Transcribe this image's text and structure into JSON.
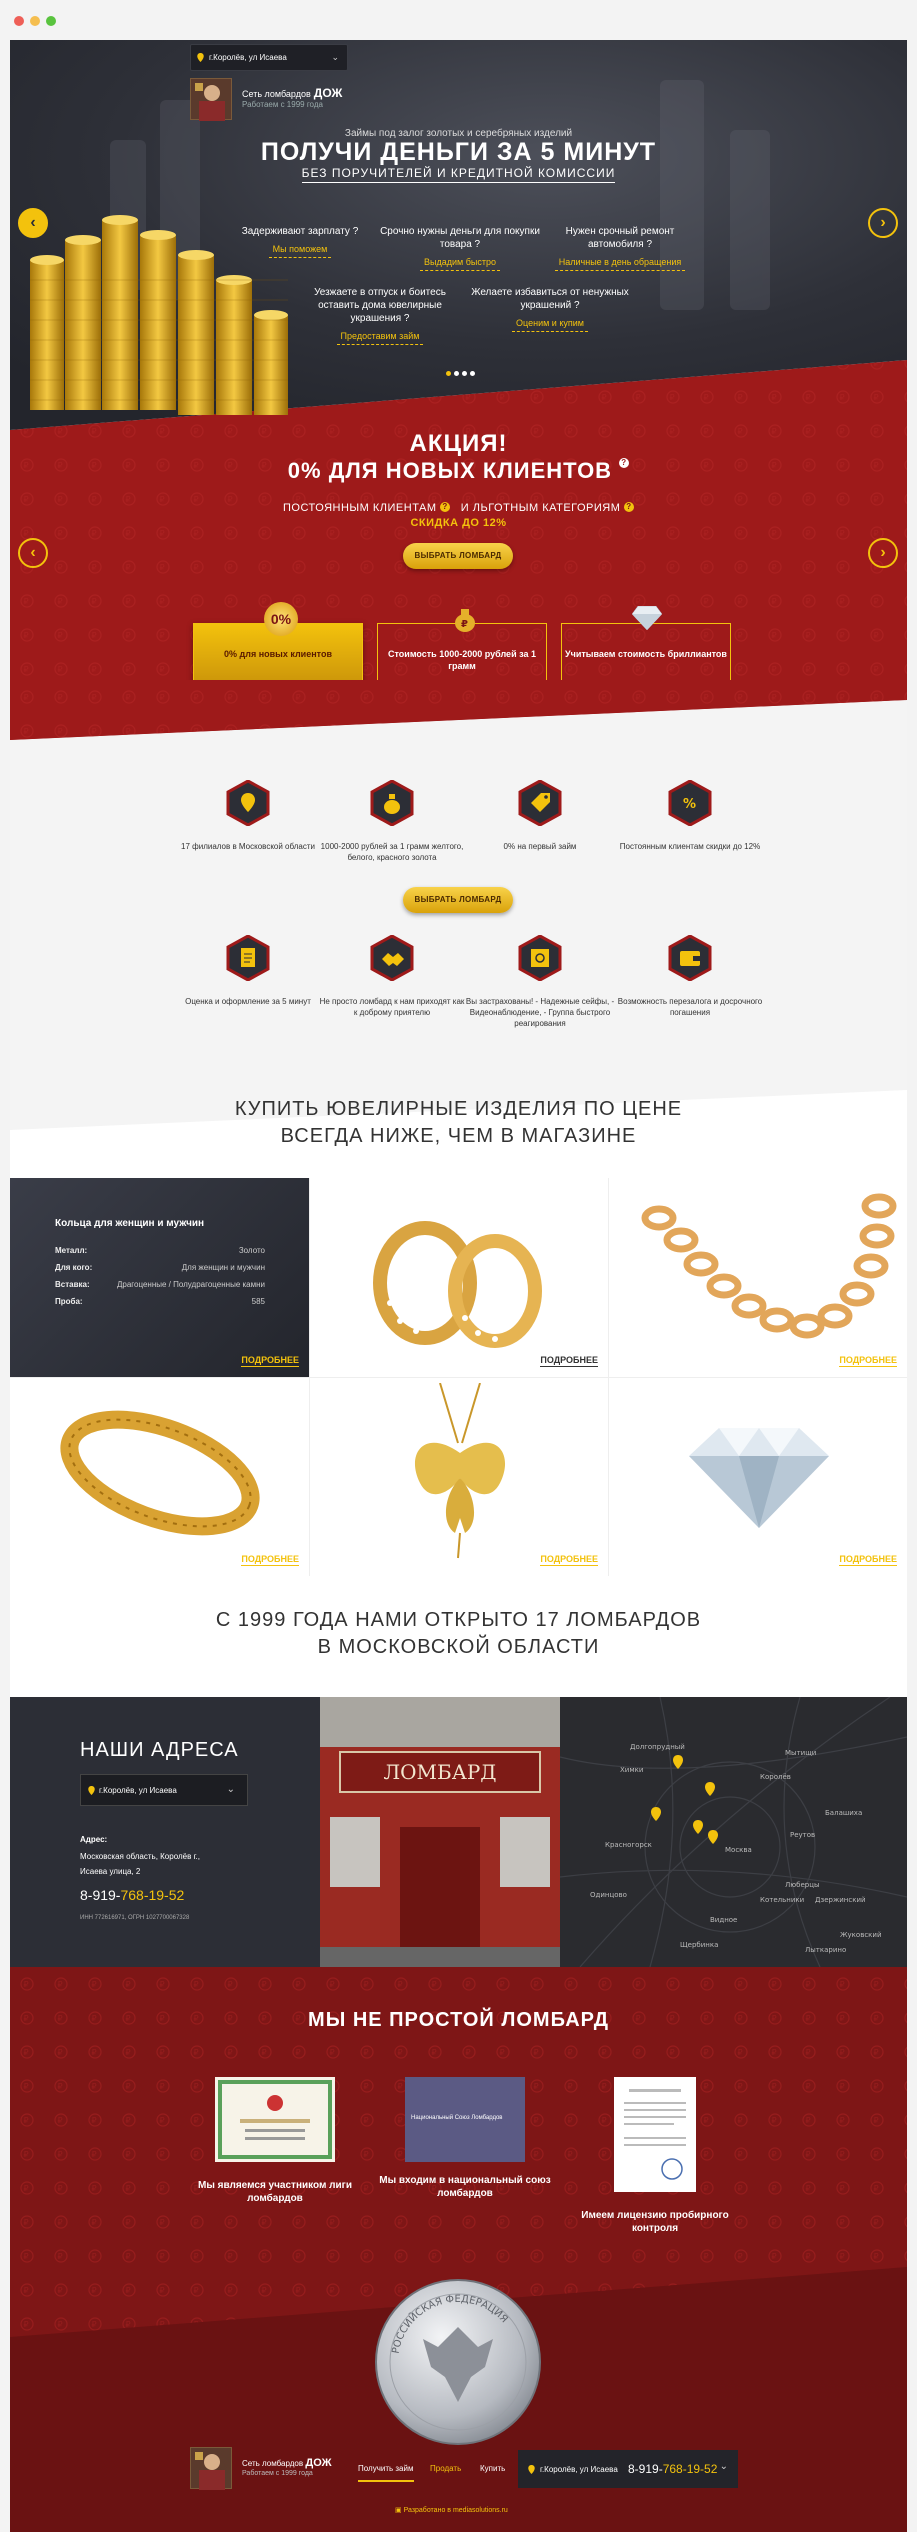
{
  "window": {
    "dots": [
      "#ee5f57",
      "#f5be4f",
      "#59c33e"
    ]
  },
  "hero": {
    "location": "г.Королёв, ул Исаева",
    "brand_prefix": "Сеть ломбардов",
    "brand_name": "ДОЖ",
    "since": "Работаем с 1999 года",
    "subtitle": "Займы под залог золотых и серебряных изделий",
    "title": "ПОЛУЧИ ДЕНЬГИ ЗА 5 МИНУТ",
    "subtitle2": "БЕЗ ПОРУЧИТЕЛЕЙ И КРЕДИТНОЙ КОМИССИИ",
    "features": [
      {
        "q": "Задерживают зарплату ?",
        "a": "Мы поможем"
      },
      {
        "q": "Срочно нужны деньги для покупки товара ?",
        "a": "Выдадим быстро"
      },
      {
        "q": "Нужен срочный ремонт автомобиля ?",
        "a": "Наличные в день обращения"
      },
      {
        "q": "Уезжаете в отпуск и боитесь оставить дома ювелирные украшения ?",
        "a": "Предоставим займ"
      },
      {
        "q": "Желаете избавиться от ненужных украшений ?",
        "a": "Оценим и купим"
      }
    ]
  },
  "promo": {
    "title": "АКЦИЯ!",
    "title2": "0% ДЛЯ НОВЫХ КЛИЕНТОВ",
    "line_a": "ПОСТОЯННЫМ КЛИЕНТАМ",
    "line_b": "И ЛЬГОТНЫМ КАТЕГОРИЯМ",
    "discount": "СКИДКА ДО 12%",
    "button": "ВЫБРАТЬ ЛОМБАРД",
    "badge": "0%",
    "cards": [
      "0% для новых клиентов",
      "Стоимость 1000-2000 рублей за 1 грамм",
      "Учитываем стоимость бриллиантов"
    ]
  },
  "advantages": {
    "row1": [
      "17 филиалов в Московской области",
      "1000-2000 рублей за 1 грамм желтого, белого, красного золота",
      "0% на первый займ",
      "Постоянным клиентам скидки до 12%"
    ],
    "button": "ВЫБРАТЬ ЛОМБАРД",
    "row2": [
      "Оценка и оформление за 5 минут",
      "Не просто ломбард к нам приходят как к доброму приятелю",
      "Вы застрахованы! - Надежные сейфы, - Видеонаблюдение, - Группа быстрого реагирования",
      "Возможность перезалога и досрочного погашения"
    ]
  },
  "jewelry": {
    "title1": "КУПИТЬ ЮВЕЛИРНЫЕ ИЗДЕЛИЯ ПО ЦЕНЕ",
    "title2": "ВСЕГДА НИЖЕ, ЧЕМ В МАГАЗИНЕ",
    "spec_title": "Кольца для женщин и мужчин",
    "specs": [
      {
        "k": "Металл:",
        "v": "Золото"
      },
      {
        "k": "Для кого:",
        "v": "Для женщин и мужчин"
      },
      {
        "k": "Вставка:",
        "v": "Драгоценные / Полудрагоценные камни"
      },
      {
        "k": "Проба:",
        "v": "585"
      }
    ],
    "more": "ПОДРОБНЕЕ"
  },
  "since_section": {
    "title1": "С 1999 ГОДА НАМИ ОТКРЫТО 17 ЛОМБАРДОВ",
    "title2": "В МОСКОВСКОЙ ОБЛАСТИ"
  },
  "address": {
    "title": "НАШИ АДРЕСА",
    "select": "г.Королёв, ул Исаева",
    "label": "Адрес:",
    "line1": "Московская область, Королёв г.,",
    "line2": "Исаева улица, 2",
    "phone_a": "8-919-",
    "phone_b": "768-19-52",
    "inn": "ИНН 772616971, ОГРН 1027700067328",
    "sign": "ЛОМБАРД",
    "map_labels": [
      "Долгопрудный",
      "Мытищи",
      "Королёв",
      "Химки",
      "Красногорск",
      "Москва",
      "Балашиха",
      "Реутов",
      "Люберцы",
      "Одинцово",
      "Видное",
      "Дзержинский",
      "Щербинка",
      "Жуковский",
      "Лыткарино",
      "Котельники"
    ]
  },
  "not_simple": {
    "title": "МЫ НЕ ПРОСТОЙ ЛОМБАРД",
    "items": [
      "Мы являемся участником лиги ломбардов",
      "Мы входим в национальный союз ломбардов",
      "Имеем лицензию пробирного контроля"
    ],
    "union_caption": "Национальный Союз Ломбардов",
    "coin_text": "РОССИЙСКАЯ ФЕДЕРАЦИЯ"
  },
  "footer": {
    "brand_prefix": "Сеть ломбардов",
    "brand_name": "ДОЖ",
    "since": "Работаем с 1999 года",
    "nav": [
      "Получить займ",
      "Продать",
      "Купить"
    ],
    "location": "г.Королёв, ул Исаева",
    "phone_a": "8-919-",
    "phone_b": "768-19-52",
    "credit": "Разработано в mediasolutions.ru"
  },
  "colors": {
    "accent": "#f3c20d",
    "dark": "#2c2e36",
    "red": "#9e1a1a",
    "deep_red": "#7e1616"
  }
}
